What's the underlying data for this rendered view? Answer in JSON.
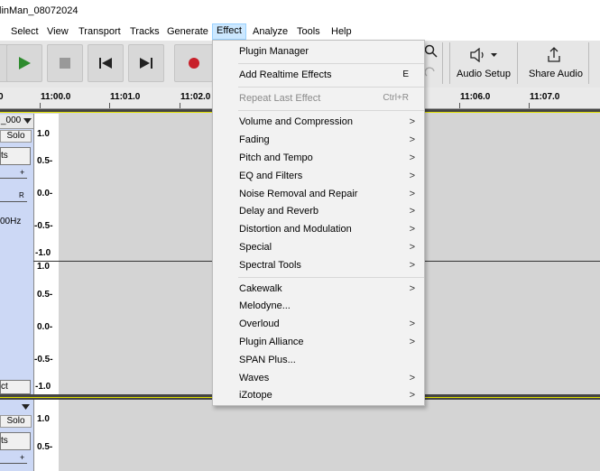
{
  "window": {
    "title": "linMan_08072024"
  },
  "menubar": {
    "items": [
      "Select",
      "View",
      "Transport",
      "Tracks",
      "Generate",
      "Effect",
      "Analyze",
      "Tools",
      "Help"
    ],
    "active": "Effect"
  },
  "toolbar": {
    "audio_setup_label": "Audio Setup",
    "share_audio_label": "Share Audio"
  },
  "ruler": {
    "labels": [
      "0",
      "11:00.0",
      "11:01.0",
      "11:02.0",
      "11:06.0",
      "11:07.0"
    ]
  },
  "tracks": [
    {
      "name_fragment": "_000",
      "solo_label": "Solo",
      "effects_label_fragment": "ts",
      "gain_plus": "+",
      "pan_right": "R",
      "rate_fragment": "00Hz",
      "select_fragment": "ct",
      "channel1_scale": [
        "1.0",
        "0.5-",
        "0.0-",
        "-0.5-",
        "-1.0"
      ],
      "channel2_scale": [
        "1.0",
        "0.5-",
        "0.0-",
        "-0.5-",
        "-1.0"
      ]
    },
    {
      "solo_label": "Solo",
      "effects_label_fragment": "ts",
      "gain_plus": "+",
      "channel1_scale": [
        "1.0",
        "0.5-"
      ]
    }
  ],
  "effect_menu": {
    "items": [
      {
        "label": "Plugin Manager",
        "shortcut": "",
        "submenu": false,
        "enabled": true
      },
      {
        "label": "Add Realtime Effects",
        "shortcut": "E",
        "submenu": false,
        "enabled": true
      },
      {
        "label": "Repeat Last Effect",
        "shortcut": "Ctrl+R",
        "submenu": false,
        "enabled": false
      },
      {
        "label": "Volume and Compression",
        "shortcut": "",
        "submenu": true,
        "enabled": true
      },
      {
        "label": "Fading",
        "shortcut": "",
        "submenu": true,
        "enabled": true
      },
      {
        "label": "Pitch and Tempo",
        "shortcut": "",
        "submenu": true,
        "enabled": true
      },
      {
        "label": "EQ and Filters",
        "shortcut": "",
        "submenu": true,
        "enabled": true
      },
      {
        "label": "Noise Removal and Repair",
        "shortcut": "",
        "submenu": true,
        "enabled": true
      },
      {
        "label": "Delay and Reverb",
        "shortcut": "",
        "submenu": true,
        "enabled": true
      },
      {
        "label": "Distortion and Modulation",
        "shortcut": "",
        "submenu": true,
        "enabled": true
      },
      {
        "label": "Special",
        "shortcut": "",
        "submenu": true,
        "enabled": true
      },
      {
        "label": "Spectral Tools",
        "shortcut": "",
        "submenu": true,
        "enabled": true
      },
      {
        "label": "Cakewalk",
        "shortcut": "",
        "submenu": true,
        "enabled": true
      },
      {
        "label": "Melodyne...",
        "shortcut": "",
        "submenu": false,
        "enabled": true
      },
      {
        "label": "Overloud",
        "shortcut": "",
        "submenu": true,
        "enabled": true
      },
      {
        "label": "Plugin Alliance",
        "shortcut": "",
        "submenu": true,
        "enabled": true
      },
      {
        "label": "SPAN Plus...",
        "shortcut": "",
        "submenu": false,
        "enabled": true
      },
      {
        "label": "Waves",
        "shortcut": "",
        "submenu": true,
        "enabled": true
      },
      {
        "label": "iZotope",
        "shortcut": "",
        "submenu": true,
        "enabled": true
      }
    ],
    "submenu_arrow": ">"
  },
  "colors": {
    "track_panel": "#ccd8f5",
    "menu_highlight": "#cce8ff",
    "record_red": "#c8202a",
    "play_green": "#2e8b2e"
  }
}
